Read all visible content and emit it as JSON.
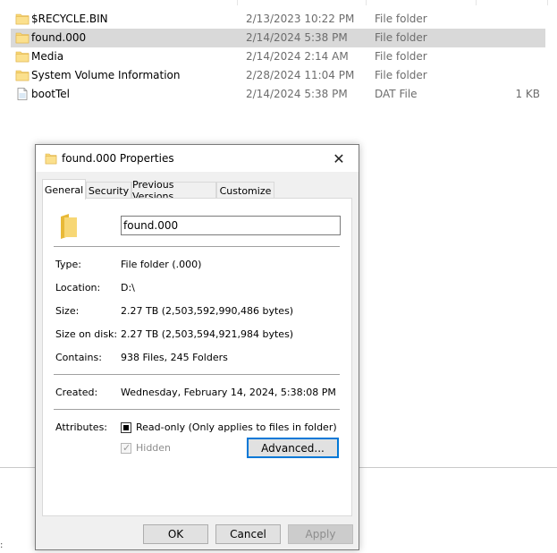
{
  "files": [
    {
      "name": "$RECYCLE.BIN",
      "date": "2/13/2023 10:22 PM",
      "type": "File folder",
      "size": "",
      "icon": "folder-icon",
      "selected": false
    },
    {
      "name": "found.000",
      "date": "2/14/2024 5:38 PM",
      "type": "File folder",
      "size": "",
      "icon": "folder-icon",
      "selected": true
    },
    {
      "name": "Media",
      "date": "2/14/2024 2:14 AM",
      "type": "File folder",
      "size": "",
      "icon": "folder-icon",
      "selected": false
    },
    {
      "name": "System Volume Information",
      "date": "2/28/2024 11:04 PM",
      "type": "File folder",
      "size": "",
      "icon": "folder-icon",
      "selected": false
    },
    {
      "name": "bootTel",
      "date": "2/14/2024 5:38 PM",
      "type": "DAT File",
      "size": "1 KB",
      "icon": "file-icon",
      "selected": false
    }
  ],
  "dialog": {
    "title": "found.000 Properties",
    "close_glyph": "✕",
    "tabs": [
      "General",
      "Security",
      "Previous Versions",
      "Customize"
    ],
    "name_value": "found.000",
    "props": {
      "type_label": "Type:",
      "type_value": "File folder (.000)",
      "location_label": "Location:",
      "location_value": "D:\\",
      "size_label": "Size:",
      "size_value": "2.27 TB (2,503,592,990,486 bytes)",
      "size_on_disk_label": "Size on disk:",
      "size_on_disk_value": "2.27 TB (2,503,594,921,984 bytes)",
      "contains_label": "Contains:",
      "contains_value": "938 Files, 245 Folders",
      "created_label": "Created:",
      "created_value": "Wednesday, February 14, 2024, 5:38:08 PM"
    },
    "attributes": {
      "label": "Attributes:",
      "readonly_label": "Read-only (Only applies to files in folder)",
      "hidden_label": "Hidden",
      "hidden_check": "✓",
      "advanced_label": "Advanced..."
    },
    "buttons": {
      "ok": "OK",
      "cancel": "Cancel",
      "apply": "Apply"
    }
  },
  "stray_text": ":",
  "colors": {
    "folder": "#f7d775",
    "folder_dark": "#e8b937",
    "accent": "#0078d7"
  }
}
